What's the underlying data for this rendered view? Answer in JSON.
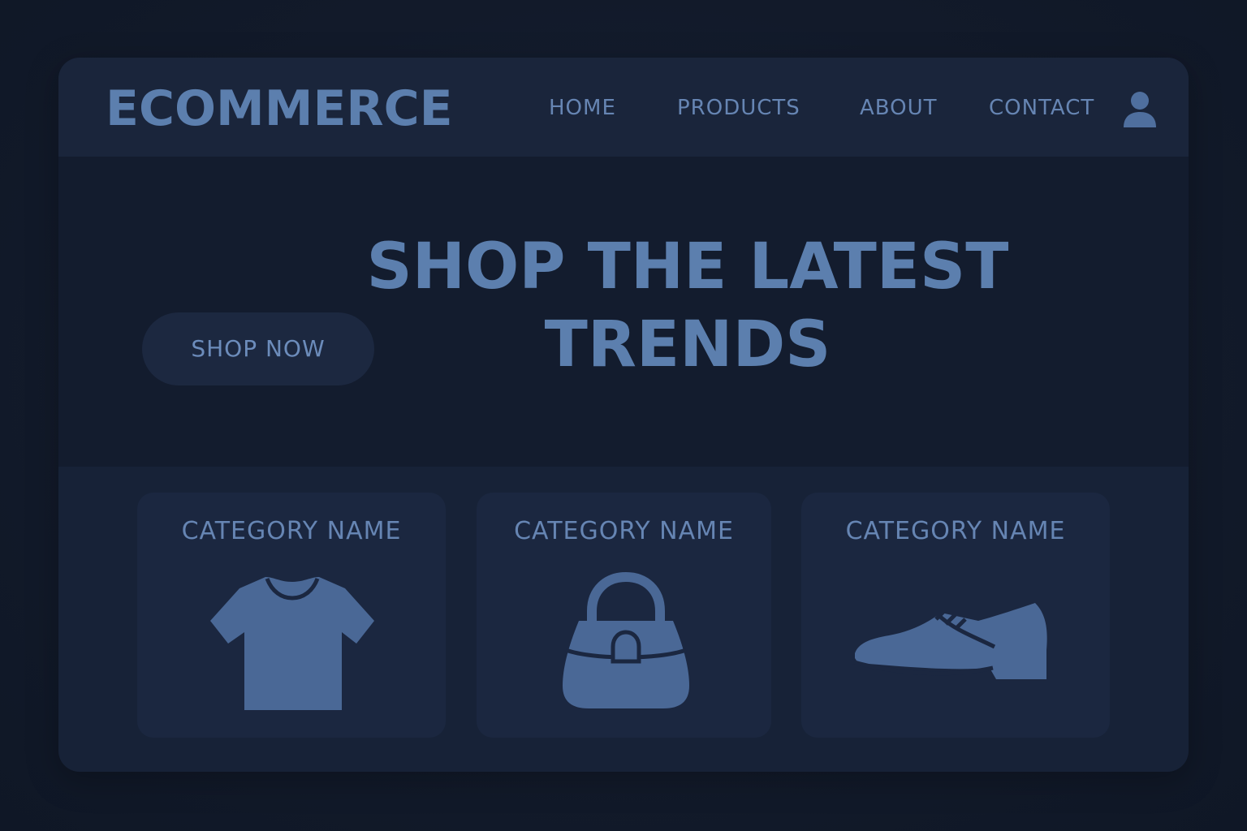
{
  "header": {
    "logo": "ECOMMERCE",
    "nav": [
      {
        "label": "HOME"
      },
      {
        "label": "PRODUCTS"
      },
      {
        "label": "ABOUT"
      },
      {
        "label": "CONTACT"
      }
    ],
    "user_icon": "user-icon"
  },
  "hero": {
    "title": "SHOP THE LATEST TRENDS",
    "cta_label": "SHOP NOW"
  },
  "categories": [
    {
      "label": "CATEGORY NAME",
      "icon": "t-shirt-icon"
    },
    {
      "label": "CATEGORY NAME",
      "icon": "handbag-icon"
    },
    {
      "label": "CATEGORY NAME",
      "icon": "shoe-icon"
    }
  ],
  "colors": {
    "background": "#121b2c",
    "navbar": "#1a253b",
    "accent": "#5c7fae",
    "icon": "#4a6896",
    "card": "#1b2740"
  }
}
